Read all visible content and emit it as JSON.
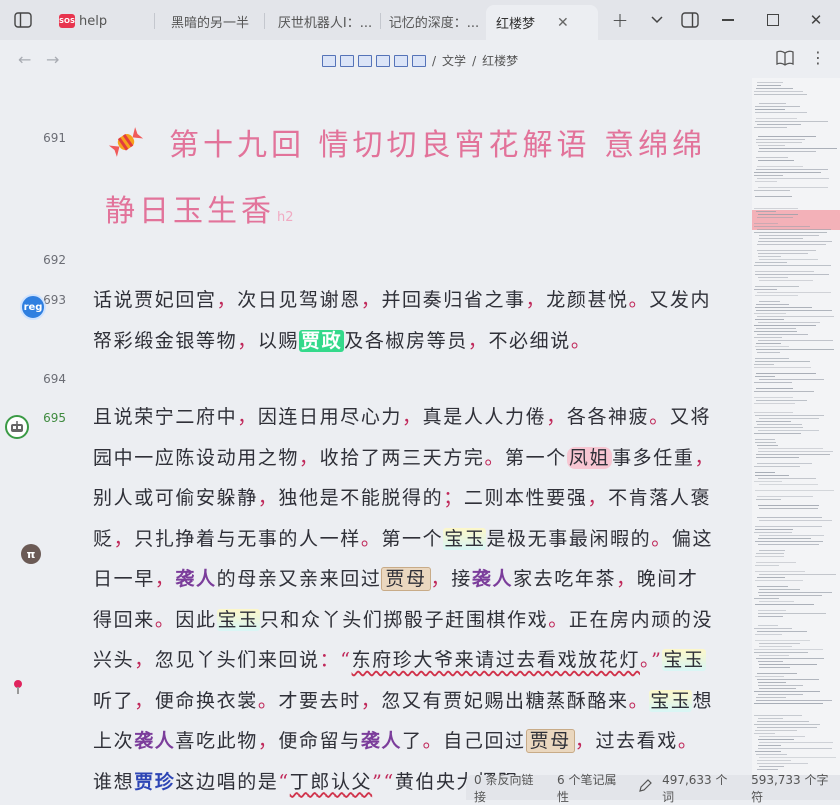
{
  "tabs": {
    "help_badge": "SOS",
    "help": "help",
    "t1": "黑暗的另一半",
    "t2": "厌世机器人I：...",
    "t3": "记忆的深度：...",
    "active": "红楼梦"
  },
  "breadcrumb": {
    "folder": "文学",
    "sep1": "/",
    "sep2": "/",
    "file": "红楼梦"
  },
  "lines": {
    "l691": "691",
    "l692": "692",
    "l693": "693",
    "l694": "694",
    "l695": "695"
  },
  "heading": {
    "line1": "第十九回 情切切良宵花解语 意绵绵",
    "line2": "静日玉生香",
    "tag": "h2"
  },
  "markers": {
    "reg": "reg",
    "pi": "π"
  },
  "p693": {
    "a": "话说贾妃回宫",
    "b": "，",
    "c": "次日见驾谢恩",
    "d": "，",
    "e": "并回奏归省之事",
    "f": "，",
    "g": "龙颜甚悦",
    "h": "。",
    "i": "又发内帑彩缎金银等物",
    "j": "，",
    "k": "以赐",
    "name": "贾政",
    "l": "及各椒房等员",
    "m": "，",
    "n": "不必细说",
    "o": "。"
  },
  "p695": {
    "s1": "且说荣宁二府中",
    "s2": "，",
    "s3": "因连日用尽心力",
    "s4": "，",
    "s5": "真是人人力倦",
    "s6": "，",
    "s7": "各各神疲",
    "s8": "。",
    "s9": "又将园中一应陈设动用之物",
    "s10": "，",
    "s11": "收拾了两三天方完",
    "s12": "。",
    "s13": "第一个",
    "fj": "凤姐",
    "s14": "事多任重",
    "s15": "，",
    "s16": "别人或可偷安躲静",
    "s17": "，",
    "s18": "独他是不能脱得的",
    "s19": "；",
    "s20": "二则本性要强",
    "s21": "，",
    "s22": "不肯落人褒贬",
    "s23": "，",
    "s24": "只扎挣着与无事的人一样",
    "s25": "。",
    "s26": "第一个",
    "by1": "宝玉",
    "s27": "是极无事最闲暇的",
    "s28": "。",
    "s29": "偏这日一早",
    "s30": "，",
    "xr1": "袭人",
    "s31": "的母亲又亲来回过",
    "jm1": "贾母",
    "s32": "，",
    "s33": "接",
    "xr2": "袭人",
    "s34": "家去吃年茶",
    "s35": "，",
    "s36": "晚间才得回来",
    "s37": "。",
    "s38": "因此",
    "by2": "宝玉",
    "s39": "只和众丫头们掷骰子赶围棋作戏",
    "s40": "。",
    "s41": "正在房内顽的没兴头",
    "s42": "，",
    "s43": "忽见丫头们来回说",
    "s44": "：",
    "q1": "“",
    "dfz": "东府珍大爷来请过去看戏放花灯",
    "s45": "。",
    "q2": "”",
    "by3": "宝玉",
    "s46": "听了",
    "s47": "，",
    "s48": "便命换衣裳",
    "s49": "。",
    "s50": "才要去时",
    "s51": "，",
    "s52": "忽又有贾妃赐出糖蒸酥酪来",
    "s53": "。",
    "by4": "宝玉",
    "s54": "想上次",
    "xr3": "袭人",
    "s55": "喜吃此物",
    "s56": "，",
    "s57": "便命留与",
    "xr4": "袭人",
    "s58": "了",
    "s59": "。",
    "s60": "自己回过",
    "jm2": "贾母",
    "s61": "，",
    "s62": "过去看戏",
    "s63": "。",
    "s64": "谁想",
    "jz": "贾珍",
    "s65": "这边唱的是",
    "q3": "“",
    "tail": "丁郎认父",
    "q4": "”",
    "q5": "“",
    "tail2": "黄伯央大摆阴"
  },
  "status": {
    "backlinks": "0 条反向链接",
    "props": "6 个笔记属性",
    "words": "497,633 个词",
    "chars": "593,733 个字符"
  },
  "colors": {
    "heading": "#e2739a",
    "punctuation": "#c0285a",
    "highlight_green": "#34d98b",
    "name_purple": "#7b3d9b",
    "name_blue": "#2d45b5"
  }
}
